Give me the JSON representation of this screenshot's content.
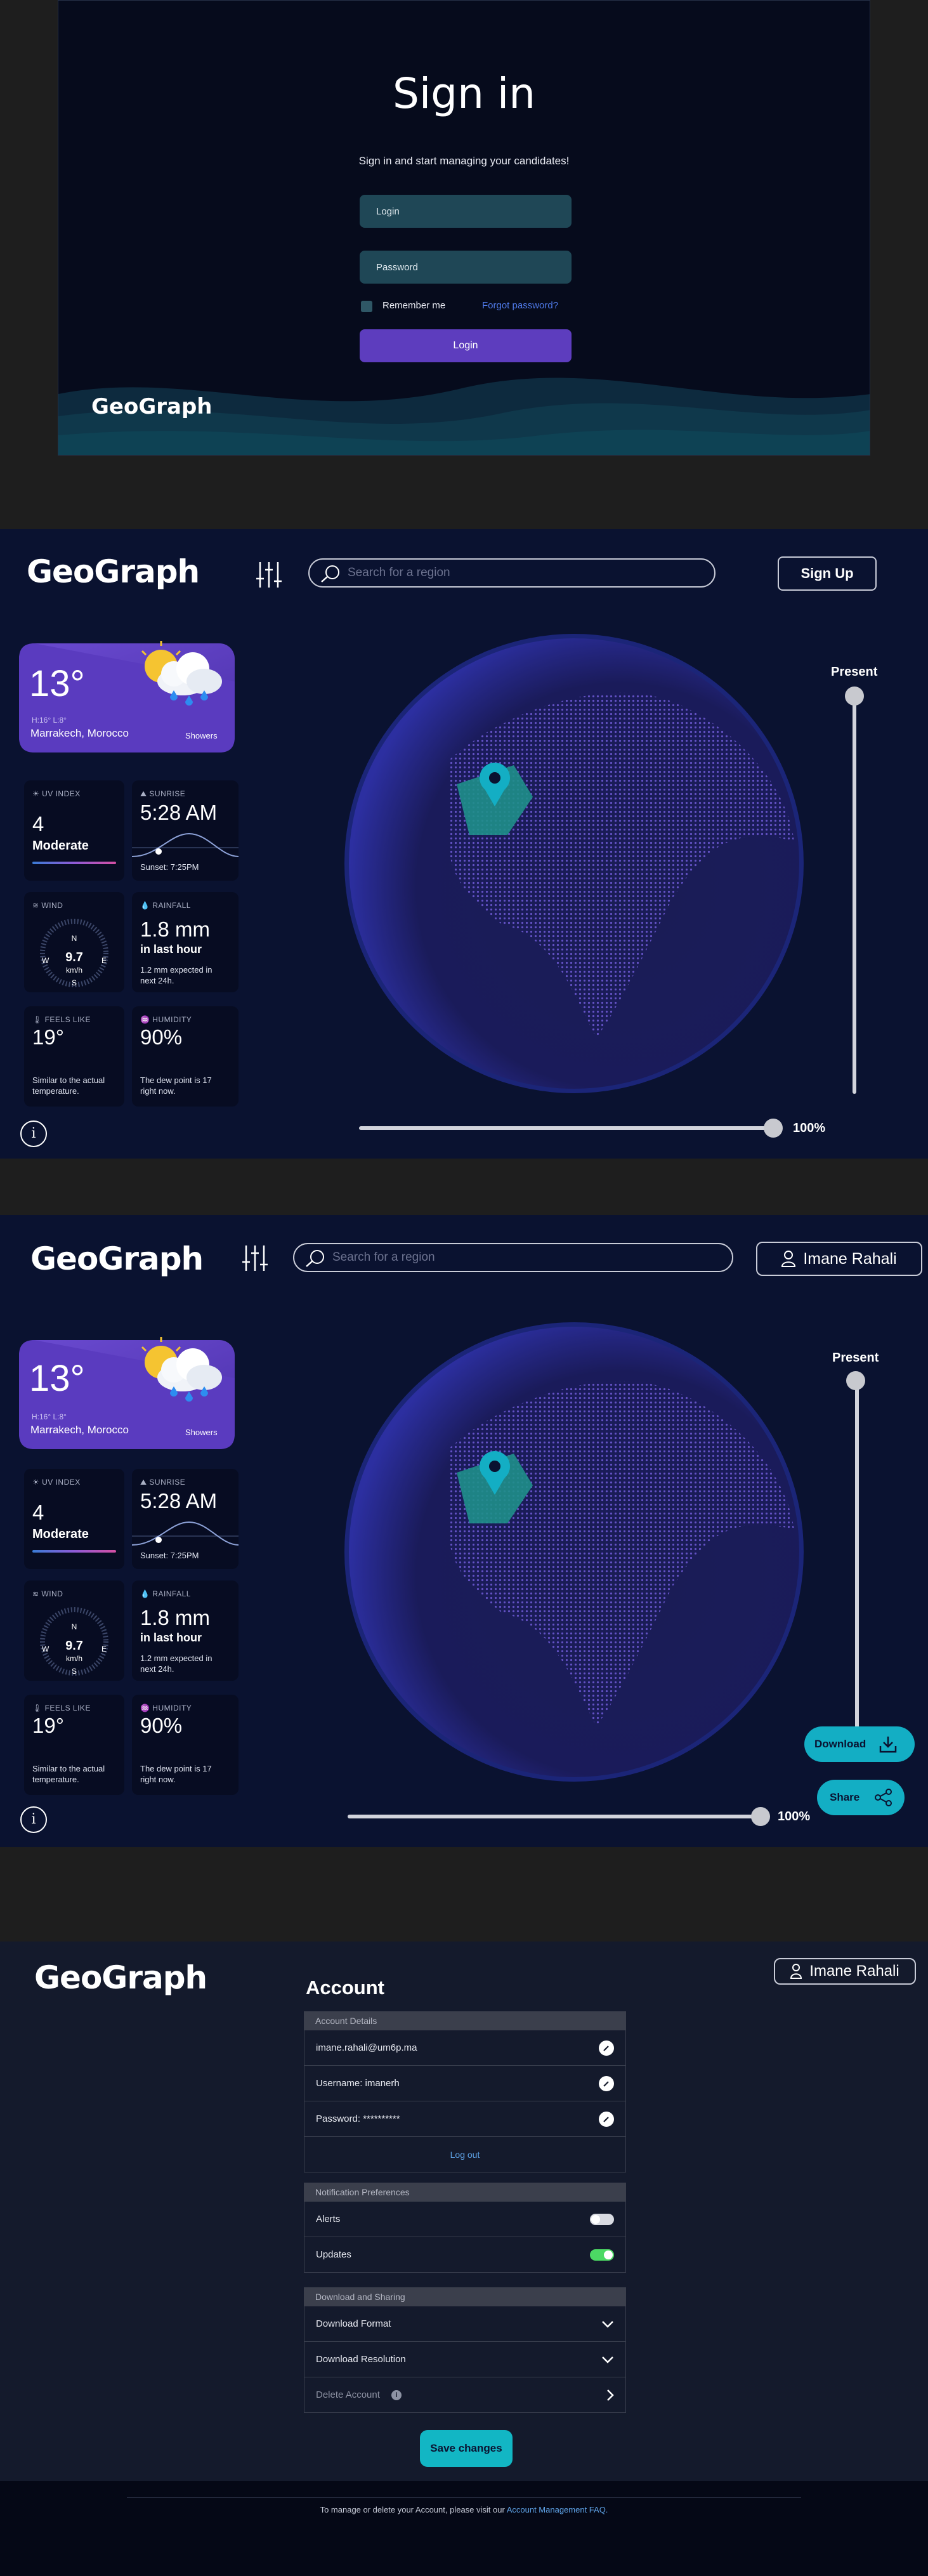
{
  "signin": {
    "title": "Sign in",
    "subtitle": "Sign in and start managing your candidates!",
    "login_placeholder": "Login",
    "password_placeholder": "Password",
    "remember_label": "Remember me",
    "forgot_label": "Forgot password?",
    "login_button": "Login",
    "brand": "GeoGraph"
  },
  "dashboard": {
    "brand": "GeoGraph",
    "search_placeholder": "Search for a region",
    "signup_button": "Sign Up",
    "user_name": "Imane Rahali",
    "weather": {
      "temp": "13°",
      "hilo": "H:16° L:8°",
      "location": "Marrakech, Morocco",
      "condition": "Showers"
    },
    "uv": {
      "label": "UV INDEX",
      "value": "4",
      "level": "Moderate",
      "fraction": 0.4
    },
    "sunrise": {
      "label": "SUNRISE",
      "time": "5:28 AM",
      "sunset": "Sunset: 7:25PM"
    },
    "wind": {
      "label": "WIND",
      "speed": "9.7",
      "unit": "km/h",
      "n": "N",
      "s": "S",
      "e": "E",
      "w": "W"
    },
    "rainfall": {
      "label": "RAINFALL",
      "amount": "1.8 mm",
      "period": "in last hour",
      "note": "1.2 mm expected in next 24h."
    },
    "feels": {
      "label": "FEELS LIKE",
      "value": "19°",
      "note": "Similar to the actual temperature."
    },
    "humidity": {
      "label": "HUMIDITY",
      "value": "90%",
      "note": "The dew point is 17 right now."
    },
    "time_label": "Present",
    "zoom": "100%",
    "zoom_fraction": 1.0,
    "download_button": "Download",
    "share_button": "Share",
    "info_glyph": "i",
    "colors": {
      "accent": "#13aec4",
      "card": "#5a3bbf",
      "background": "#0a1230"
    }
  },
  "account": {
    "brand": "GeoGraph",
    "user_name": "Imane Rahali",
    "title": "Account",
    "details_header": "Account Details",
    "email": "imane.rahali@um6p.ma",
    "username": "Username: imanerh",
    "password": "Password: **********",
    "logout": "Log out",
    "notif_header": "Notification Preferences",
    "alerts_label": "Alerts",
    "alerts_on": false,
    "updates_label": "Updates",
    "updates_on": true,
    "download_header": "Download and Sharing",
    "format_label": "Download Format",
    "resolution_label": "Download Resolution",
    "delete_label": "Delete Account",
    "save_button": "Save changes",
    "footer_text": "To manage or delete your Account, please visit our",
    "footer_link": "Account Management FAQ."
  }
}
